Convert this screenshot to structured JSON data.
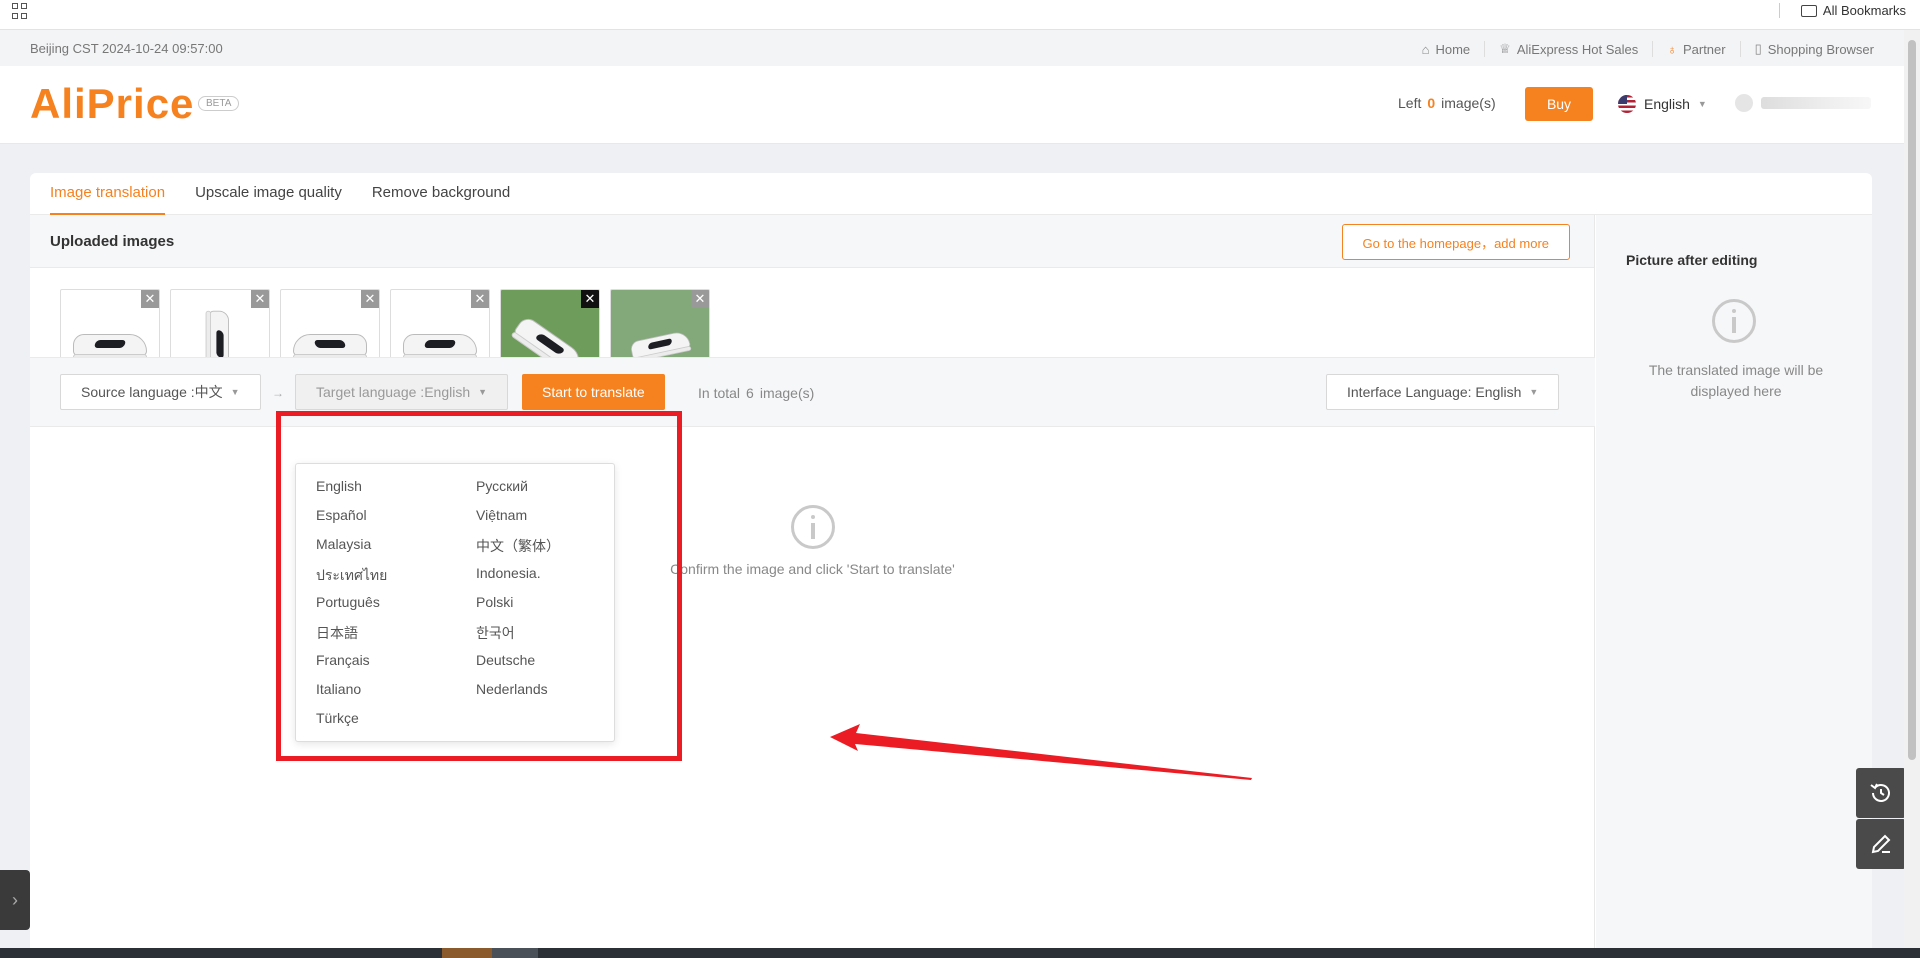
{
  "browser": {
    "all_bookmarks": "All Bookmarks"
  },
  "topbar": {
    "timezone": "Beijing CST  2024-10-24 09:57:00",
    "links": [
      {
        "label": "Home",
        "icon": "home-icon"
      },
      {
        "label": "AliExpress Hot Sales",
        "icon": "crown-icon"
      },
      {
        "label": "Partner",
        "icon": "money-bag-icon"
      },
      {
        "label": "Shopping Browser",
        "icon": "phone-icon"
      }
    ]
  },
  "header": {
    "logo": "AliPrice",
    "beta": "BETA",
    "left_prefix": "Left",
    "left_count": "0",
    "left_suffix": "image(s)",
    "buy_label": "Buy",
    "language": "English"
  },
  "tabs": [
    {
      "label": "Image translation",
      "active": true
    },
    {
      "label": "Upscale image quality",
      "active": false
    },
    {
      "label": "Remove background",
      "active": false
    }
  ],
  "uploaded": {
    "title": "Uploaded images",
    "homepage_button": "Go to the homepage，add more",
    "image_count": 6
  },
  "controls": {
    "source_language": "Source language :中文",
    "target_language": "Target language :English",
    "start_button": "Start to translate",
    "total_prefix": "In total",
    "total_count": "6",
    "total_suffix": "image(s)",
    "interface_language": "Interface Language: English"
  },
  "dropdown": {
    "options": [
      "English",
      "Русский",
      "Español",
      "Việtnam",
      "Malaysia",
      "中文（繁体）",
      "ประเทศไทย",
      "Indonesia.",
      "Português",
      "Polski",
      "日本語",
      "한국어",
      "Français",
      "Deutsche",
      "Italiano",
      "Nederlands",
      "Türkçe"
    ]
  },
  "empty_state": {
    "message": "Confirm the image and click 'Start to translate'"
  },
  "right_panel": {
    "title": "Picture after editing",
    "message": "The translated image will be displayed here"
  },
  "colors": {
    "accent": "#f5811f",
    "annotation": "#ec1c24"
  }
}
